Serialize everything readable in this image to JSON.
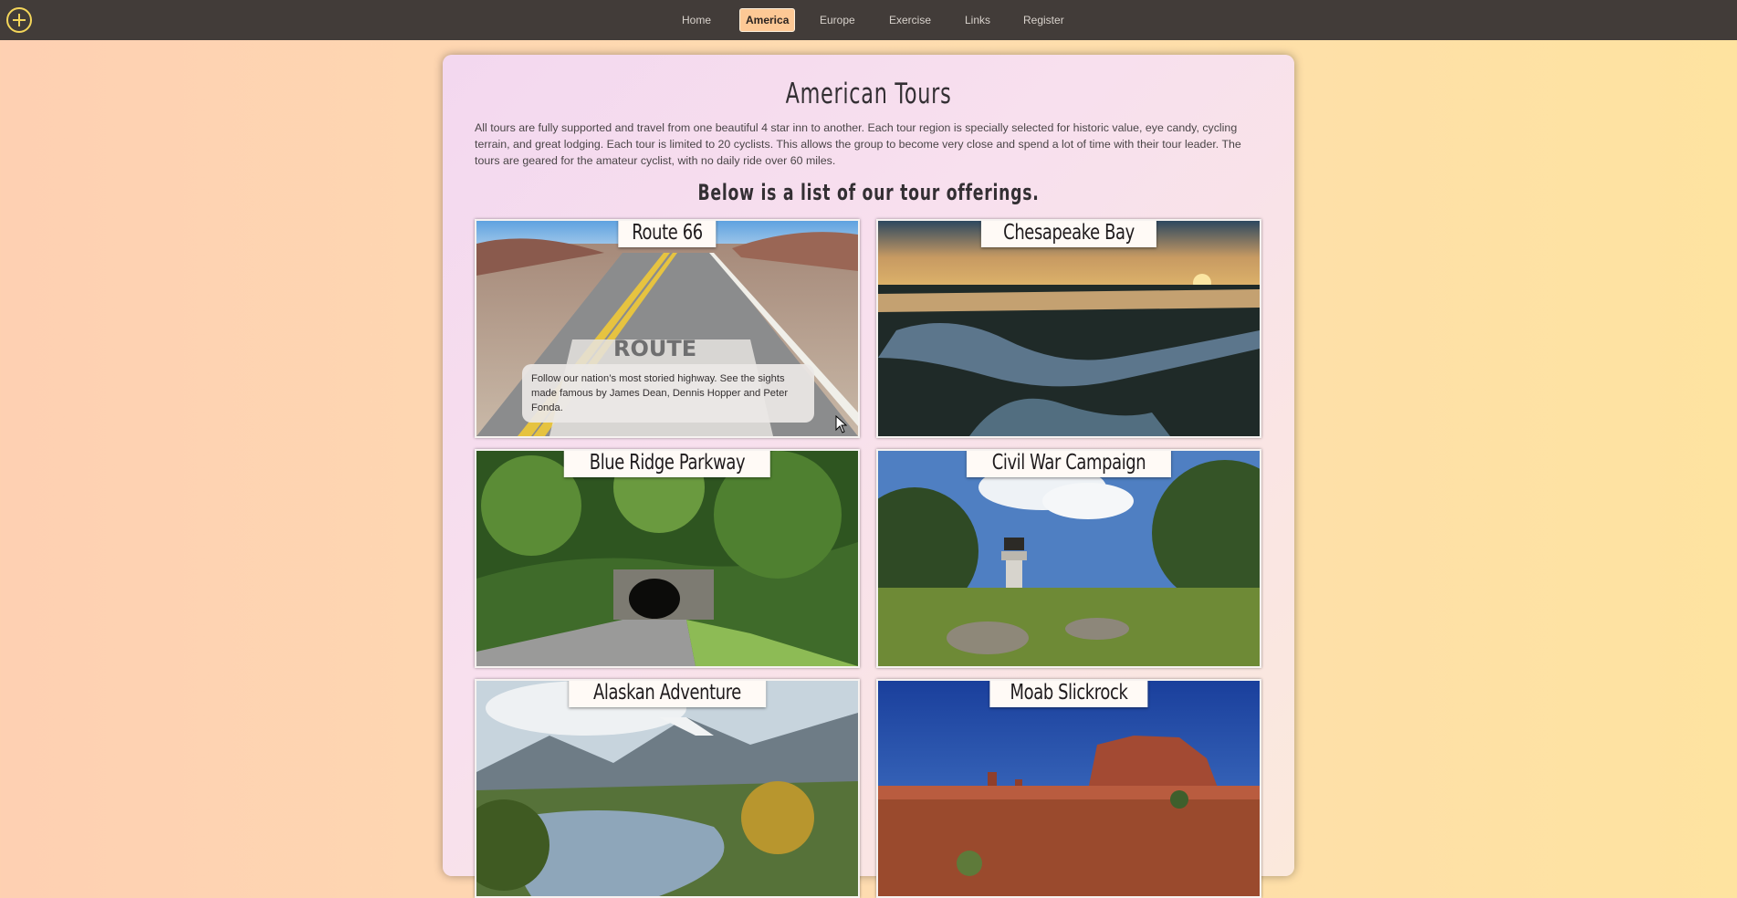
{
  "nav": {
    "items": [
      {
        "label": "Home",
        "active": false
      },
      {
        "label": "America",
        "active": true
      },
      {
        "label": "Europe",
        "active": false
      },
      {
        "label": "Exercise",
        "active": false
      },
      {
        "label": "Links",
        "active": false
      },
      {
        "label": "Register",
        "active": false
      }
    ]
  },
  "page": {
    "title": "American Tours",
    "intro": "All tours are fully supported and travel from one beautiful 4 star inn to another. Each tour region is specially selected for historic value, eye candy, cycling terrain, and great lodging. Each tour is limited to 20 cyclists. This allows the group to become very close and spend a lot of time with their tour leader. The tours are geared for the amateur cyclist, with no daily ride over 60 miles.",
    "subtitle": "Below is a list of our tour offerings."
  },
  "tours": [
    {
      "label": "Route 66",
      "description": "Follow our nation’s most storied highway. See the sights made famous by James Dean, Dennis Hopper and Peter Fonda."
    },
    {
      "label": "Chesapeake Bay"
    },
    {
      "label": "Blue Ridge Parkway"
    },
    {
      "label": "Civil War Campaign"
    },
    {
      "label": "Alaskan Adventure"
    },
    {
      "label": "Moab Slickrock"
    }
  ],
  "colors": {
    "nav_bg": "#423c39",
    "nav_active": "#fdc895",
    "logo": "#f4d65a"
  }
}
